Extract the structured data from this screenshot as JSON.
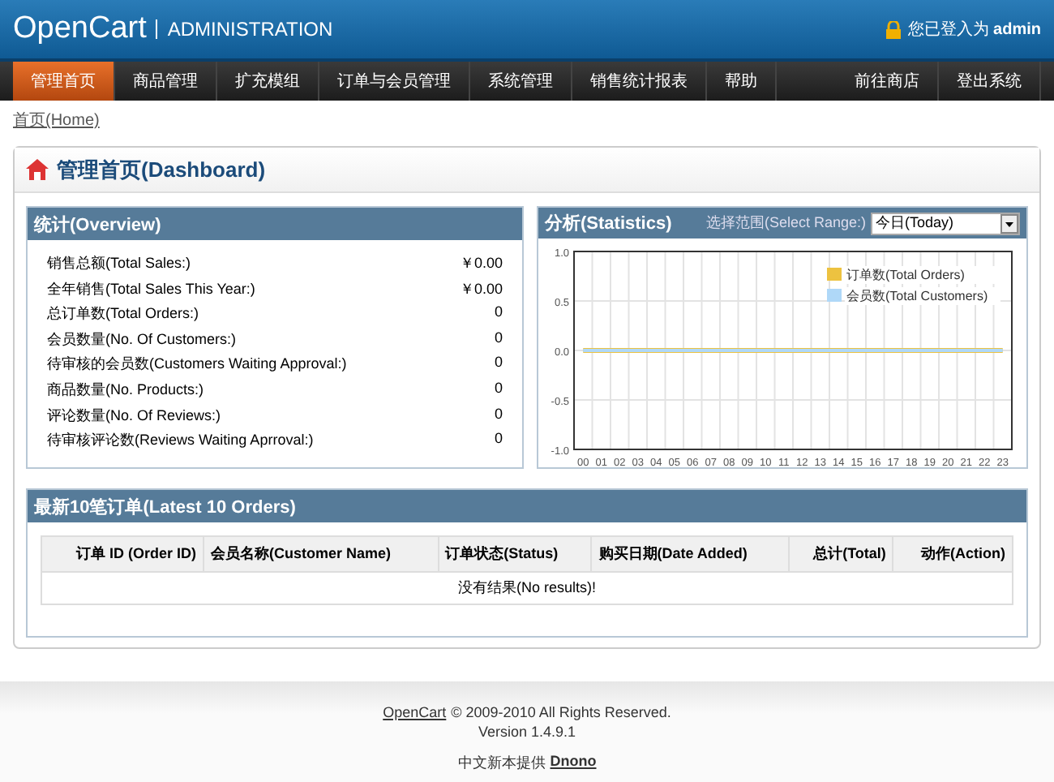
{
  "header": {
    "logo": "OpenCart",
    "subtitle": "ADMINISTRATION",
    "login_text": "您已登入为",
    "user": "admin"
  },
  "menu": {
    "left": [
      {
        "label": "管理首页",
        "selected": true
      },
      {
        "label": "商品管理",
        "selected": false
      },
      {
        "label": "扩充模组",
        "selected": false
      },
      {
        "label": "订单与会员管理",
        "selected": false
      },
      {
        "label": "系统管理",
        "selected": false
      },
      {
        "label": "销售统计报表",
        "selected": false
      },
      {
        "label": "帮助",
        "selected": false
      }
    ],
    "right": [
      {
        "label": "前往商店",
        "selected": false
      },
      {
        "label": "登出系统",
        "selected": false
      }
    ]
  },
  "breadcrumb": "首页(Home)",
  "page_title": "管理首页(Dashboard)",
  "overview": {
    "title": "统计(Overview)",
    "rows": [
      {
        "label": "销售总额(Total Sales:)",
        "value": "￥0.00"
      },
      {
        "label": "全年销售(Total Sales This Year:)",
        "value": "￥0.00"
      },
      {
        "label": "总订单数(Total Orders:)",
        "value": "0"
      },
      {
        "label": "会员数量(No. Of Customers:)",
        "value": "0"
      },
      {
        "label": "待审核的会员数(Customers Waiting Approval:)",
        "value": "0"
      },
      {
        "label": "商品数量(No. Products:)",
        "value": "0"
      },
      {
        "label": "评论数量(No. Of Reviews:)",
        "value": "0"
      },
      {
        "label": "待审核评论数(Reviews Waiting Aprroval:)",
        "value": "0"
      }
    ]
  },
  "statistics": {
    "title": "分析(Statistics)",
    "range_label": "选择范围(Select Range:)",
    "range_value": "今日(Today)",
    "chart_data": {
      "type": "line",
      "categories": [
        "00",
        "01",
        "02",
        "03",
        "04",
        "05",
        "06",
        "07",
        "08",
        "09",
        "10",
        "11",
        "12",
        "13",
        "14",
        "15",
        "16",
        "17",
        "18",
        "19",
        "20",
        "21",
        "22",
        "23"
      ],
      "ylim": [
        -1,
        1
      ],
      "yticks": [
        {
          "value": -1,
          "label": "-1.0"
        },
        {
          "value": -0.5,
          "label": "-0.5"
        },
        {
          "value": 0,
          "label": "0.0"
        },
        {
          "value": 0.5,
          "label": "0.5"
        },
        {
          "value": 1,
          "label": "1.0"
        }
      ],
      "legend": "top-right",
      "grid": true,
      "series": [
        {
          "name": "订单数(Total Orders)",
          "color": "#edc240",
          "values": [
            0,
            0,
            0,
            0,
            0,
            0,
            0,
            0,
            0,
            0,
            0,
            0,
            0,
            0,
            0,
            0,
            0,
            0,
            0,
            0,
            0,
            0,
            0,
            0
          ]
        },
        {
          "name": "会员数(Total Customers)",
          "color": "#afd8f8",
          "values": [
            0,
            0,
            0,
            0,
            0,
            0,
            0,
            0,
            0,
            0,
            0,
            0,
            0,
            0,
            0,
            0,
            0,
            0,
            0,
            0,
            0,
            0,
            0,
            0
          ]
        }
      ]
    }
  },
  "latest_orders": {
    "title": "最新10笔订单(Latest 10 Orders)",
    "columns": [
      "订单 ID (Order ID)",
      "会员名称(Customer Name)",
      "订单状态(Status)",
      "购买日期(Date Added)",
      "总计(Total)",
      "动作(Action)"
    ],
    "empty": "没有结果(No results)!"
  },
  "footer": {
    "brand": "OpenCart",
    "copyright": "© 2009-2010 All Rights Reserved.",
    "version": "Version 1.4.9.1",
    "translation": "中文新本提供",
    "translator": "Dnono"
  }
}
